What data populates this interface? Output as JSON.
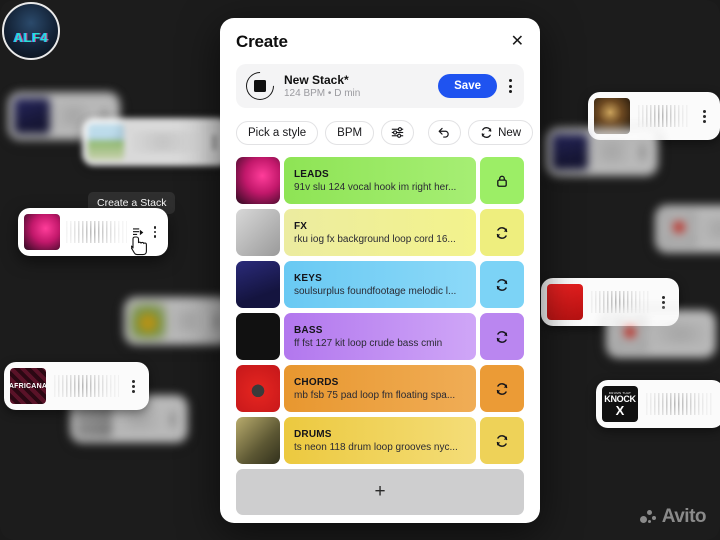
{
  "logo": {
    "label": "ALF4",
    "name": "alf4-logo"
  },
  "tooltip": {
    "text": "Create a Stack"
  },
  "modal": {
    "title": "Create",
    "close_label": "✕",
    "stack": {
      "name": "New Stack*",
      "subtitle": "124 BPM • D min",
      "save_label": "Save",
      "icon": "stop-circle-icon"
    },
    "toolbar": [
      {
        "label": "Pick a style",
        "name": "pick-a-style-button",
        "icon": ""
      },
      {
        "label": "BPM",
        "name": "bpm-button",
        "icon": ""
      },
      {
        "label": "",
        "name": "mixer-settings-button",
        "icon": "sliders-icon"
      },
      {
        "label": "",
        "name": "undo-button",
        "icon": "undo-arrow-icon"
      },
      {
        "label": "New",
        "name": "new-button",
        "icon": "refresh-icon"
      }
    ],
    "tracks": [
      {
        "name": "LEADS",
        "description": "91v slu 124 vocal hook im right her...",
        "color": "#8ee455",
        "color2": "#9ef06a",
        "action_icon": "lock-icon",
        "art": "art-sweetlies"
      },
      {
        "name": "FX",
        "description": "rku iog fx background loop cord 16...",
        "color": "#ecec7c",
        "color2": "#f2f29a",
        "action_icon": "refresh-icon",
        "art": "art-gray"
      },
      {
        "name": "KEYS",
        "description": "soulsurplus foundfootage melodic l...",
        "color": "#72cdf4",
        "color2": "#8fdbf8",
        "action_icon": "refresh-icon",
        "art": "art-navy"
      },
      {
        "name": "BASS",
        "description": "ff fst 127 kit loop crude bass cmin",
        "color": "#b277ee",
        "color2": "#c79af5",
        "action_icon": "refresh-icon",
        "art": "art-knock"
      },
      {
        "name": "CHORDS",
        "description": "mb fsb 75 pad loop fm floating spa...",
        "color": "#e8972f",
        "color2": "#efa94c",
        "action_icon": "refresh-icon",
        "art": "art-red"
      },
      {
        "name": "DRUMS",
        "description": "ts neon 118 drum loop grooves nyc...",
        "color": "#ecc93f",
        "color2": "#f2da6e",
        "action_icon": "refresh-icon",
        "art": "art-olive"
      }
    ],
    "add_label": "+"
  },
  "background_cards": [
    {
      "name": "bg-card-navy",
      "art": "art-navy",
      "label": ""
    },
    {
      "name": "bg-card-garden",
      "art": "art-garden",
      "label": ""
    },
    {
      "name": "bg-card-sweetlies",
      "art": "art-sweetlies",
      "label": ""
    },
    {
      "name": "bg-card-lemon",
      "art": "art-lemon",
      "label": ""
    },
    {
      "name": "bg-card-africana",
      "art": "art-africana",
      "label": "AFRICANA"
    },
    {
      "name": "bg-card-gray",
      "art": "art-gray",
      "label": ""
    },
    {
      "name": "bg-card-portrait",
      "art": "art-portrait",
      "label": ""
    },
    {
      "name": "bg-card-redgift",
      "art": "art-redgift",
      "label": ""
    },
    {
      "name": "bg-card-redsm",
      "art": "art-redsm",
      "label": ""
    },
    {
      "name": "bg-card-knock",
      "art": "art-knock",
      "label": "KNOCK X"
    }
  ],
  "knock_art": {
    "line1": "DRUMS THAT",
    "line2": "KNOCK",
    "line3": "X"
  },
  "watermark": {
    "text": "Avito"
  },
  "colors": {
    "accent": "#1f53f0",
    "modal_bg": "#ffffff",
    "page_bg": "#1c1c1c",
    "add_row": "#cececf"
  }
}
